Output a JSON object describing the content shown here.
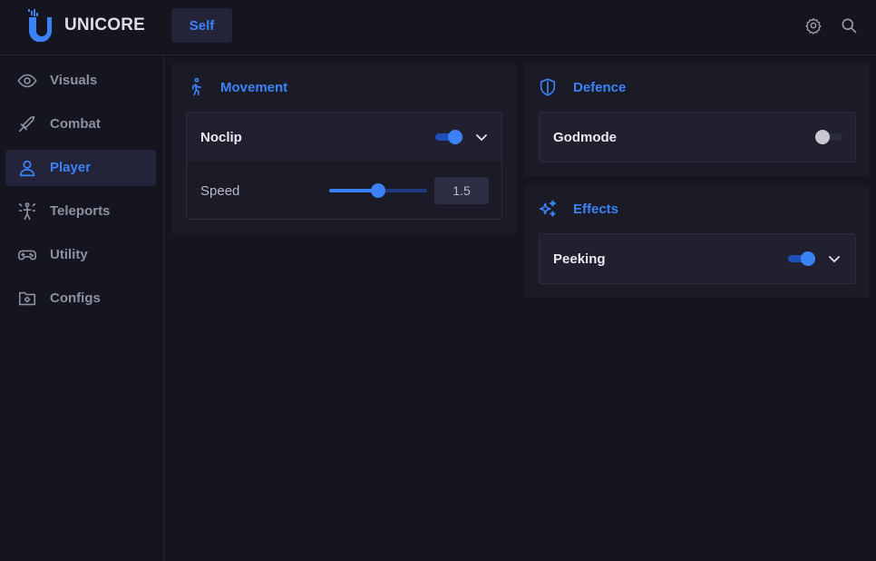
{
  "header": {
    "brand": "UNICORE",
    "tabs": [
      {
        "label": "Self",
        "active": true
      }
    ],
    "icons": [
      "gear-icon",
      "search-icon"
    ]
  },
  "sidebar": {
    "items": [
      {
        "label": "Visuals",
        "icon": "eye-icon",
        "active": false
      },
      {
        "label": "Combat",
        "icon": "sword-icon",
        "active": false
      },
      {
        "label": "Player",
        "icon": "user-icon",
        "active": true
      },
      {
        "label": "Teleports",
        "icon": "teleport-icon",
        "active": false
      },
      {
        "label": "Utility",
        "icon": "gamepad-icon",
        "active": false
      },
      {
        "label": "Configs",
        "icon": "folder-settings-icon",
        "active": false
      }
    ]
  },
  "main": {
    "movement": {
      "title": "Movement",
      "icon": "walking-icon",
      "noclip": {
        "label": "Noclip",
        "enabled": true,
        "expanded": true
      },
      "speed": {
        "label": "Speed",
        "value": "1.5",
        "fraction": 0.5
      }
    },
    "defence": {
      "title": "Defence",
      "icon": "shield-icon",
      "godmode": {
        "label": "Godmode",
        "enabled": false
      }
    },
    "effects": {
      "title": "Effects",
      "icon": "sparkles-icon",
      "peeking": {
        "label": "Peeking",
        "enabled": true
      }
    }
  },
  "colors": {
    "accent": "#3b82f6",
    "background": "#15151f",
    "panel": "#1b1b28",
    "row": "#20202f"
  }
}
